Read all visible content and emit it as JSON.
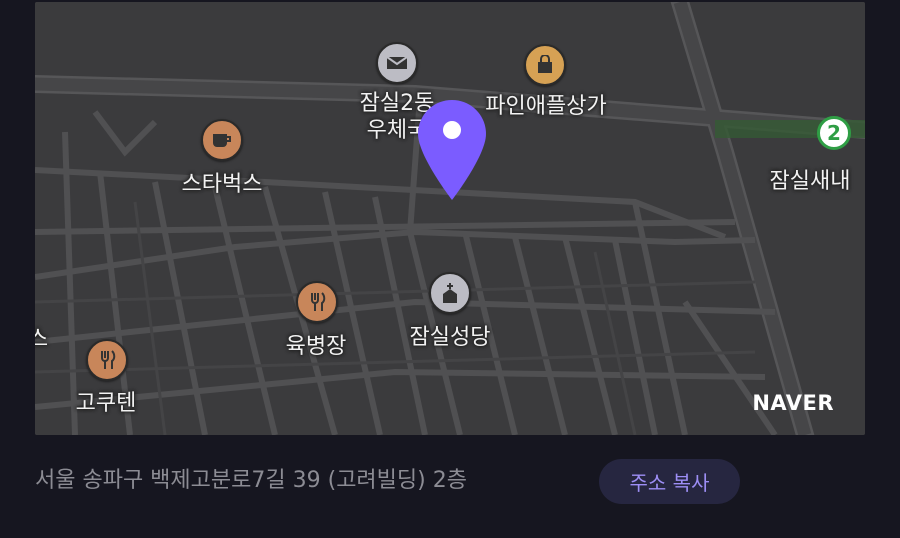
{
  "map": {
    "pois": [
      {
        "name": "잠실2동\n우체국",
        "icon": "post-office-icon",
        "color": "#bcbcc4"
      },
      {
        "name": "파인애플상가",
        "icon": "shopping-bag-icon",
        "color": "#d6a154"
      },
      {
        "name": "스타벅스",
        "icon": "cafe-icon",
        "color": "#c8865a"
      },
      {
        "name": "육병장",
        "icon": "restaurant-icon",
        "color": "#c8865a"
      },
      {
        "name": "잠실성당",
        "icon": "church-icon",
        "color": "#bcbcc4"
      },
      {
        "name": "고쿠텐",
        "icon": "restaurant-icon",
        "color": "#c8865a"
      }
    ],
    "post_line1": "잠실2동",
    "post_line2": "우체국",
    "pineapple": "파인애플상가",
    "starbucks": "스타벅스",
    "yukbyeongjang": "육병장",
    "church": "잠실성당",
    "gokuten": "고쿠텐",
    "station": "잠실새내",
    "subway_line": "2",
    "edge_label": "스",
    "logo": "NAVER",
    "pin_color": "#7b5cff"
  },
  "address": {
    "text": "서울 송파구 백제고분로7길 39 (고려빌딩) 2층",
    "copy_label": "주소 복사"
  }
}
